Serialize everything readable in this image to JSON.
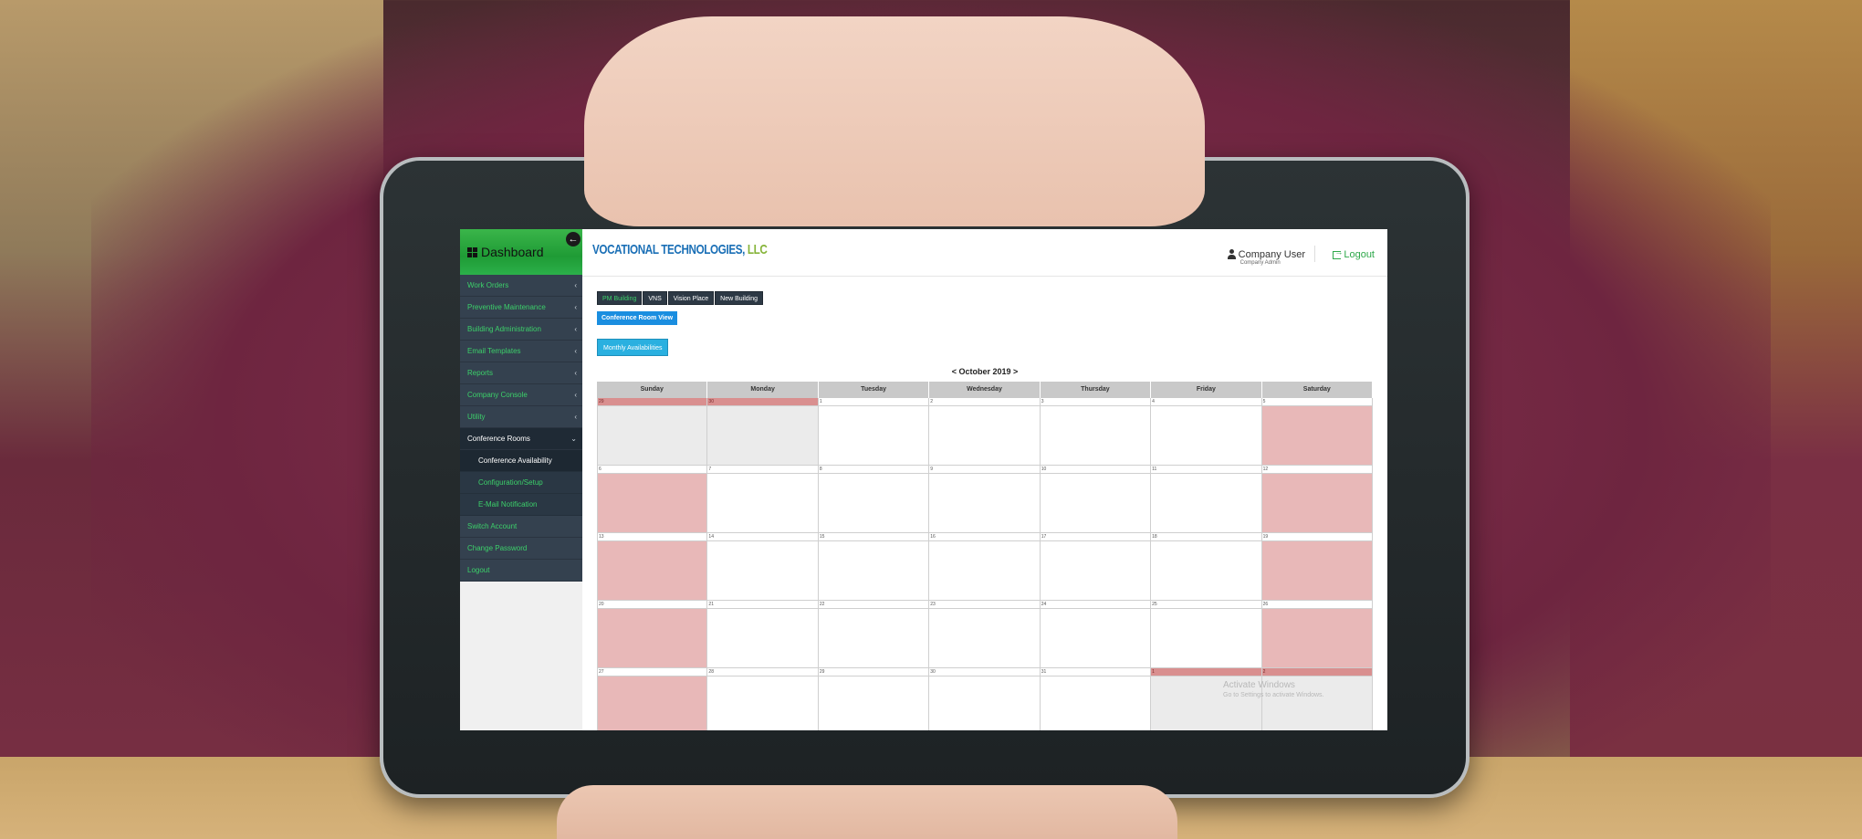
{
  "sidebar": {
    "title": "Dashboard",
    "back_icon": "arrow-left-icon",
    "items": [
      {
        "label": "Work Orders"
      },
      {
        "label": "Preventive Maintenance"
      },
      {
        "label": "Building Administration"
      },
      {
        "label": "Email Templates"
      },
      {
        "label": "Reports"
      },
      {
        "label": "Company Console"
      },
      {
        "label": "Utility"
      }
    ],
    "expanded": {
      "label": "Conference Rooms",
      "subitems": [
        {
          "label": "Conference Availability"
        },
        {
          "label": "Configuration/Setup"
        },
        {
          "label": "E-Mail Notification"
        }
      ]
    },
    "bottom_items": [
      {
        "label": "Switch Account"
      },
      {
        "label": "Change Password"
      },
      {
        "label": "Logout"
      }
    ]
  },
  "header": {
    "brand_part1": "VOCATIONAL TECHNOLOGIES,",
    "brand_part2": "LLC",
    "user_name": "Company User",
    "user_role": "Company Admin",
    "logout_label": "Logout"
  },
  "buildings": {
    "tabs": [
      {
        "label": "PM Building"
      },
      {
        "label": "VNS"
      },
      {
        "label": "Vision Place"
      },
      {
        "label": "New Building"
      }
    ]
  },
  "buttons": {
    "conference_room_view": "Conference Room View",
    "monthly_availabilities": "Monthly Availabilities"
  },
  "calendar": {
    "month_label": "< October 2019 >",
    "weekdays": [
      "Sunday",
      "Monday",
      "Tuesday",
      "Wednesday",
      "Thursday",
      "Friday",
      "Saturday"
    ],
    "weeks": [
      [
        {
          "d": "29",
          "past": true,
          "fill": "grey"
        },
        {
          "d": "30",
          "past": true,
          "fill": "grey"
        },
        {
          "d": "1"
        },
        {
          "d": "2"
        },
        {
          "d": "3"
        },
        {
          "d": "4"
        },
        {
          "d": "5",
          "fill": "pink"
        }
      ],
      [
        {
          "d": "6",
          "fill": "pink"
        },
        {
          "d": "7"
        },
        {
          "d": "8"
        },
        {
          "d": "9"
        },
        {
          "d": "10"
        },
        {
          "d": "11"
        },
        {
          "d": "12",
          "fill": "pink"
        }
      ],
      [
        {
          "d": "13",
          "fill": "pink"
        },
        {
          "d": "14"
        },
        {
          "d": "15"
        },
        {
          "d": "16"
        },
        {
          "d": "17"
        },
        {
          "d": "18"
        },
        {
          "d": "19",
          "fill": "pink"
        }
      ],
      [
        {
          "d": "20",
          "fill": "pink"
        },
        {
          "d": "21"
        },
        {
          "d": "22"
        },
        {
          "d": "23"
        },
        {
          "d": "24"
        },
        {
          "d": "25"
        },
        {
          "d": "26",
          "fill": "pink"
        }
      ],
      [
        {
          "d": "27",
          "fill": "pink"
        },
        {
          "d": "28"
        },
        {
          "d": "29"
        },
        {
          "d": "30"
        },
        {
          "d": "31"
        },
        {
          "d": "1",
          "past": true,
          "fill": "grey"
        },
        {
          "d": "2",
          "past": true,
          "fill": "grey"
        }
      ]
    ]
  },
  "watermark": {
    "title": "Activate Windows",
    "subtitle": "Go to Settings to activate Windows."
  },
  "colors": {
    "sidebar_bg": "#34414f",
    "accent_green": "#3cd06a",
    "booked_pink": "#e8b8b8",
    "other_month_red": "#d98f8f",
    "button_blue": "#1a8ee0"
  }
}
